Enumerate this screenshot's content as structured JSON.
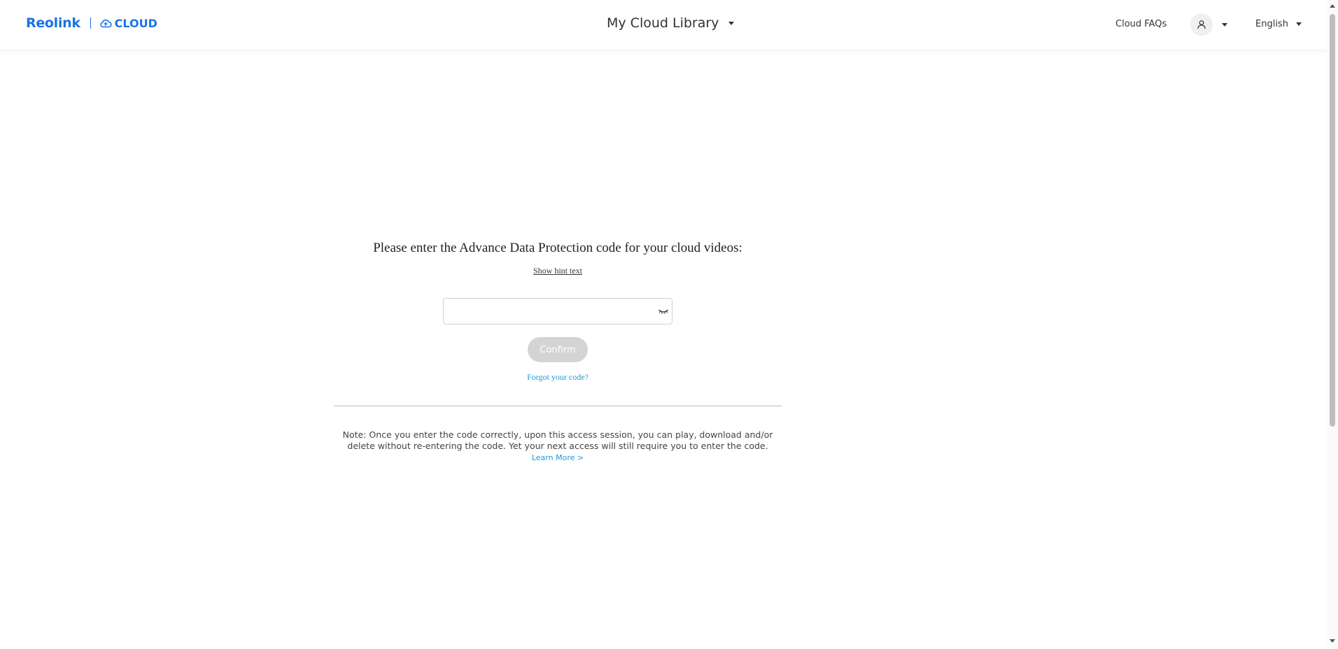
{
  "header": {
    "brand": {
      "name": "Reolink",
      "product": "CLOUD"
    },
    "library_title": "My Cloud Library",
    "faq_label": "Cloud FAQs",
    "language": "English"
  },
  "colors": {
    "brand": "#1a73e8",
    "link": "#1a9bd7",
    "button_disabled": "#d4d4d4"
  },
  "icons": {
    "account": "user-icon",
    "password_toggle": "eye-closed-icon"
  },
  "main": {
    "prompt": "Please enter the Advance Data Protection code for your cloud videos:",
    "hint_link": "Show hint text",
    "code_input": {
      "value": "",
      "placeholder": ""
    },
    "confirm_label": "Confirm",
    "forgot_link": "Forgot your code?",
    "note_text": "Note: Once you enter the code correctly, upon this access session, you can play, download and/or delete without re-entering the code. Yet your next access will still require you to enter the code.",
    "learn_more": "Learn More >"
  }
}
